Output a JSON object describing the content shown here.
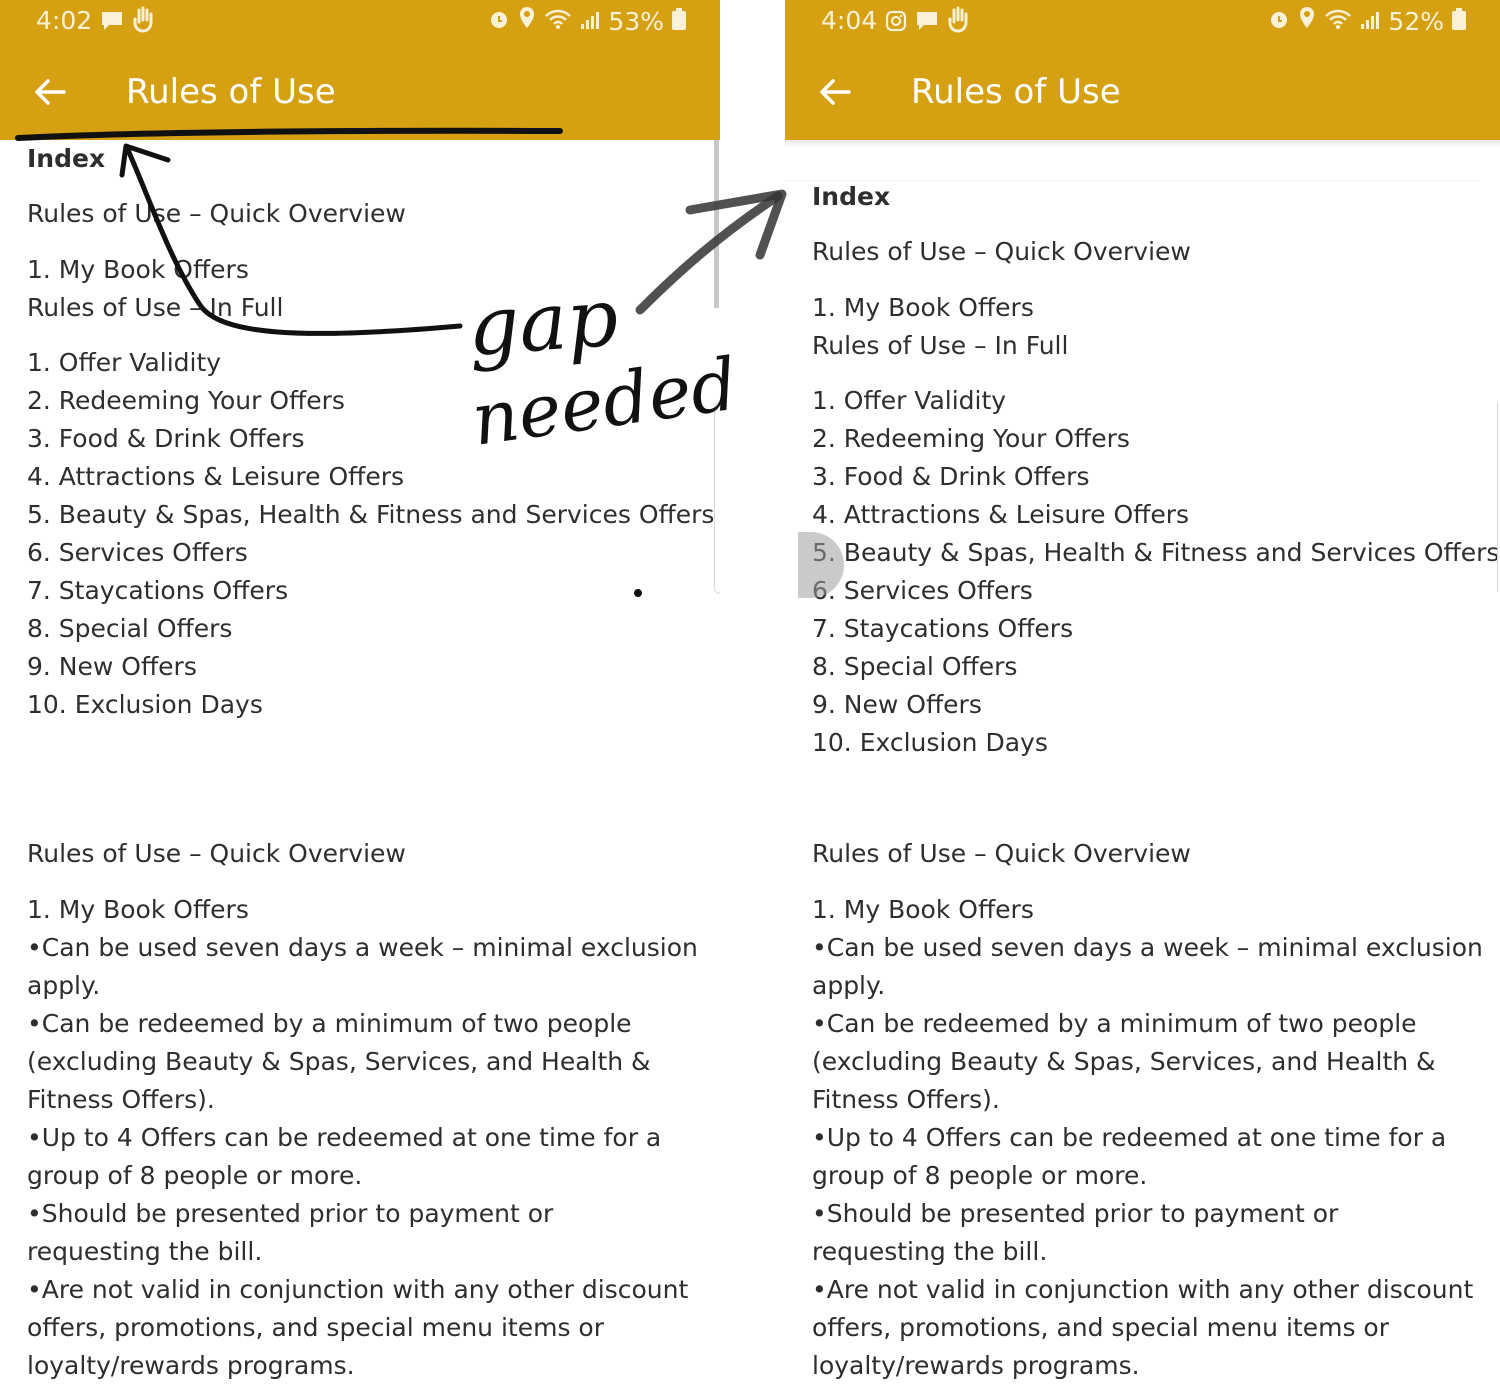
{
  "left": {
    "status": {
      "time": "4:02",
      "battery": "53%"
    },
    "header": {
      "title": "Rules of Use"
    }
  },
  "right": {
    "status": {
      "time": "4:04",
      "battery": "52%"
    },
    "header": {
      "title": "Rules of Use"
    }
  },
  "index": {
    "heading": "Index",
    "quick_overview": "Rules of Use – Quick Overview",
    "item_my_book": "1. My Book Offers",
    "in_full": "Rules of Use – In Full",
    "items": [
      "1. Offer Validity",
      "2. Redeeming Your Offers",
      "3. Food & Drink Offers",
      "4. Attractions & Leisure Offers",
      "5. Beauty & Spas, Health & Fitness and Services Offers",
      "6. Services Offers",
      "7. Staycations Offers",
      "8. Special Offers",
      "9. New Offers",
      "10. Exclusion Days"
    ]
  },
  "overview": {
    "heading": "Rules of Use – Quick Overview",
    "sub": "1. My Book Offers",
    "bullets": [
      {
        "first": "Can be used seven days a week – minimal exclusion",
        "rest": [
          "apply."
        ]
      },
      {
        "first": "Can be redeemed by a minimum of two people",
        "rest": [
          "(excluding Beauty & Spas, Services, and Health &",
          "Fitness Offers)."
        ]
      },
      {
        "first": "Up to 4 Offers can be redeemed at one time for a",
        "rest": [
          "group of 8 people or more."
        ]
      },
      {
        "first": "Should be presented prior to payment or",
        "rest": [
          "requesting the bill."
        ]
      },
      {
        "first": "Are not valid in conjunction with any other discount",
        "rest": [
          "offers, promotions, and special menu items or",
          "loyalty/rewards programs."
        ]
      }
    ]
  },
  "annotation": {
    "line1": "gap",
    "line2": "needed"
  },
  "colors": {
    "appbar": "#d5a012",
    "text": "#2e2e2e",
    "ink": "#111111"
  }
}
